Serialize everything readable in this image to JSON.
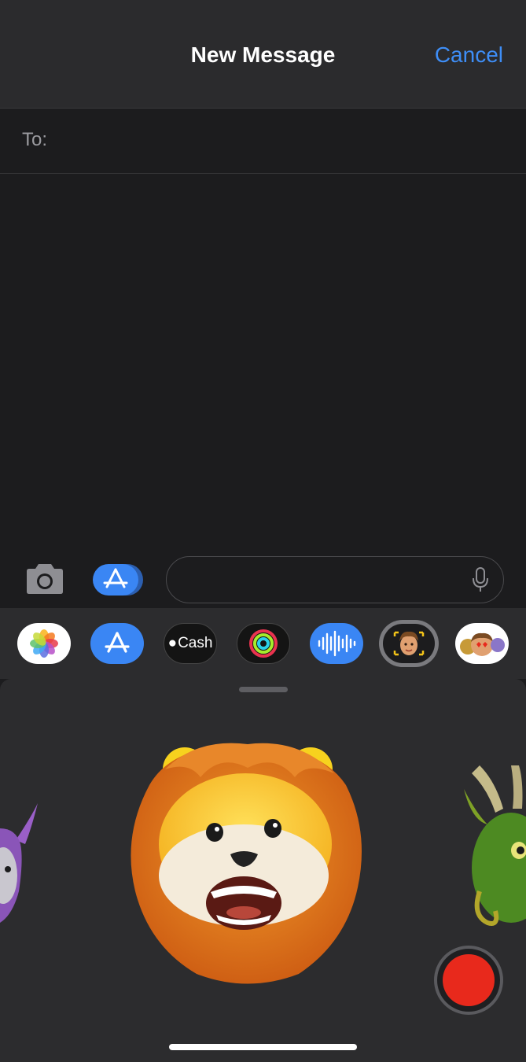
{
  "header": {
    "title": "New Message",
    "cancel_label": "Cancel"
  },
  "recipient": {
    "label": "To:",
    "add_icon": "plus-circle-icon"
  },
  "message_field": {
    "placeholder": "",
    "mic_icon": "microphone-icon"
  },
  "toolbar": {
    "camera_icon": "camera-icon",
    "apps_icon": "app-store-icon"
  },
  "app_drawer": {
    "apps": [
      {
        "name": "Photos",
        "icon": "photos-icon"
      },
      {
        "name": "App Store",
        "icon": "app-store-icon"
      },
      {
        "name": "Cash",
        "label": "Cash",
        "icon": "apple-cash-icon"
      },
      {
        "name": "Activity",
        "icon": "activity-rings-icon"
      },
      {
        "name": "Audio",
        "icon": "audio-waveform-icon"
      },
      {
        "name": "Memoji Stickers",
        "icon": "memoji-icon"
      },
      {
        "name": "Memoji Stickers 2",
        "icon": "memoji-stickers-icon"
      }
    ]
  },
  "animoji": {
    "selected": "lion",
    "carousel": [
      "unicorn",
      "lion",
      "dragon"
    ]
  },
  "colors": {
    "accent": "#3e8ef7",
    "record": "#e8291c",
    "background": "#1c1c1e",
    "panel": "#2c2c2e"
  }
}
